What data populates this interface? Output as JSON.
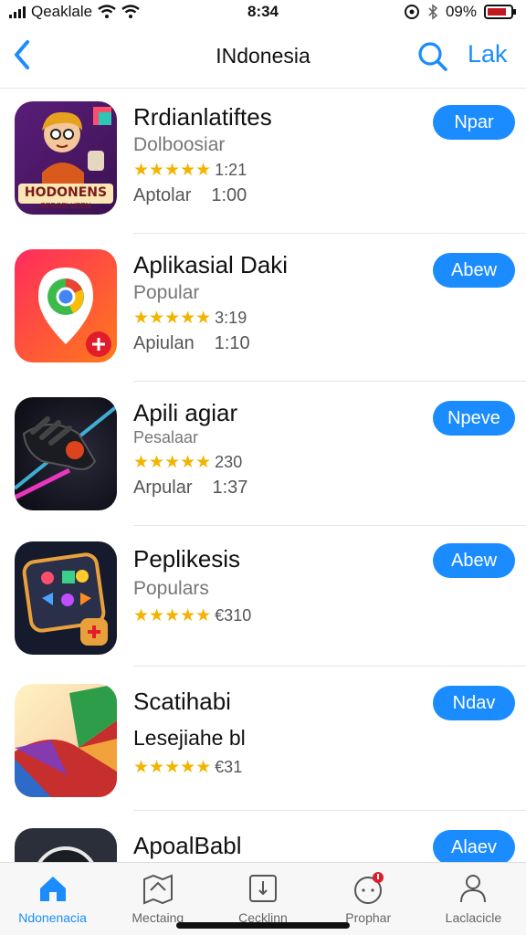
{
  "status": {
    "carrier": "Qeaklale",
    "time": "8:34",
    "battery": "09%"
  },
  "nav": {
    "title": "INdonesia",
    "action": "Lak"
  },
  "apps": [
    {
      "name": "Rrdianlatiftes",
      "sub": "Dolboosiar",
      "rating": "1:21",
      "meta_a": "Aptolar",
      "meta_b": "1:00",
      "button": "Npar",
      "icon_text": "HODONENS",
      "icon_subtext": "BERGELUEEN"
    },
    {
      "name": "Aplikasial Daki",
      "sub": "Popular",
      "rating": "3:19",
      "meta_a": "Apiulan",
      "meta_b": "1:10",
      "button": "Abew"
    },
    {
      "name": "Apili agiar",
      "sub": "Pesalaar",
      "rating": "230",
      "meta_a": "Arpular",
      "meta_b": "1:37",
      "button": "Npeve"
    },
    {
      "name": "Peplikesis",
      "sub": "Populars",
      "rating": "€310",
      "meta_a": "",
      "meta_b": "",
      "button": "Abew"
    },
    {
      "name": "Scatihabi",
      "sub": "Lesejiahe bl",
      "rating": "€31",
      "meta_a": "",
      "meta_b": "",
      "button": "Ndav"
    },
    {
      "name": "ApoalBabl",
      "sub": "",
      "rating": "",
      "meta_a": "",
      "meta_b": "",
      "button": "Alaev"
    }
  ],
  "tabs": [
    {
      "label": "Ndonenacia",
      "icon": "home-icon"
    },
    {
      "label": "Mectaing",
      "icon": "map-icon"
    },
    {
      "label": "Cecklinn",
      "icon": "calendar-icon"
    },
    {
      "label": "Prophar",
      "icon": "chat-icon"
    },
    {
      "label": "Laclacicle",
      "icon": "person-icon"
    }
  ],
  "colors": {
    "accent": "#1a8cff",
    "star": "#f2b400"
  }
}
